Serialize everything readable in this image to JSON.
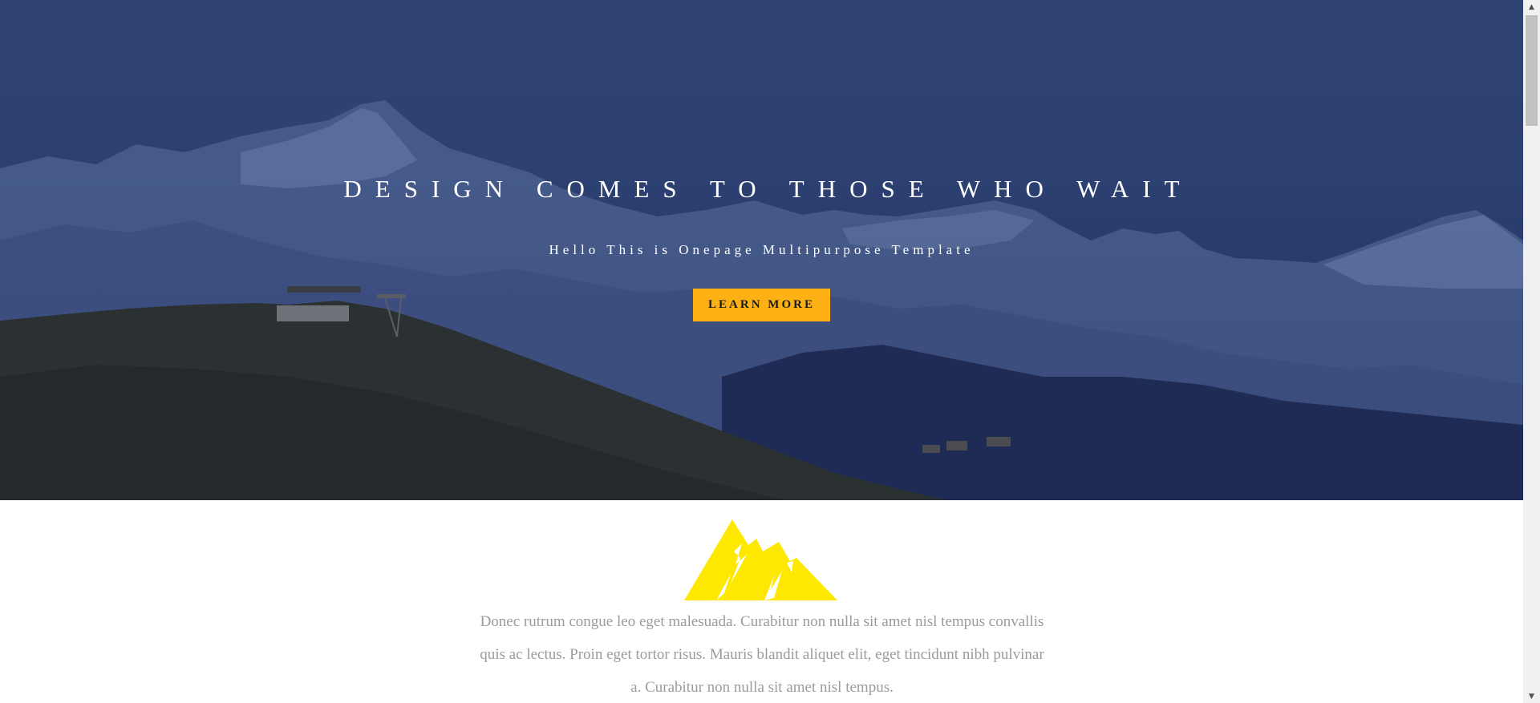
{
  "hero": {
    "title": "DESIGN COMES TO THOSE WHO WAIT",
    "subtitle": "Hello This is Onepage Multipurpose Template",
    "cta_label": "LEARN MORE",
    "background_image": "mountain-landscape",
    "overlay_color": "#2b3f72"
  },
  "intro": {
    "logo_icon": "mountain-icon",
    "logo_color": "#ffe800",
    "paragraph": "Donec rutrum congue leo eget malesuada. Curabitur non nulla sit amet nisl tempus convallis quis ac lectus. Proin eget tortor risus. Mauris blandit aliquet elit, eget tincidunt nibh pulvinar a. Curabitur non nulla sit amet nisl tempus."
  },
  "colors": {
    "accent": "#fdb114",
    "text_muted": "#9b9b9b"
  },
  "scrollbar": {
    "up_icon": "triangle-up-icon",
    "down_icon": "triangle-down-icon"
  }
}
